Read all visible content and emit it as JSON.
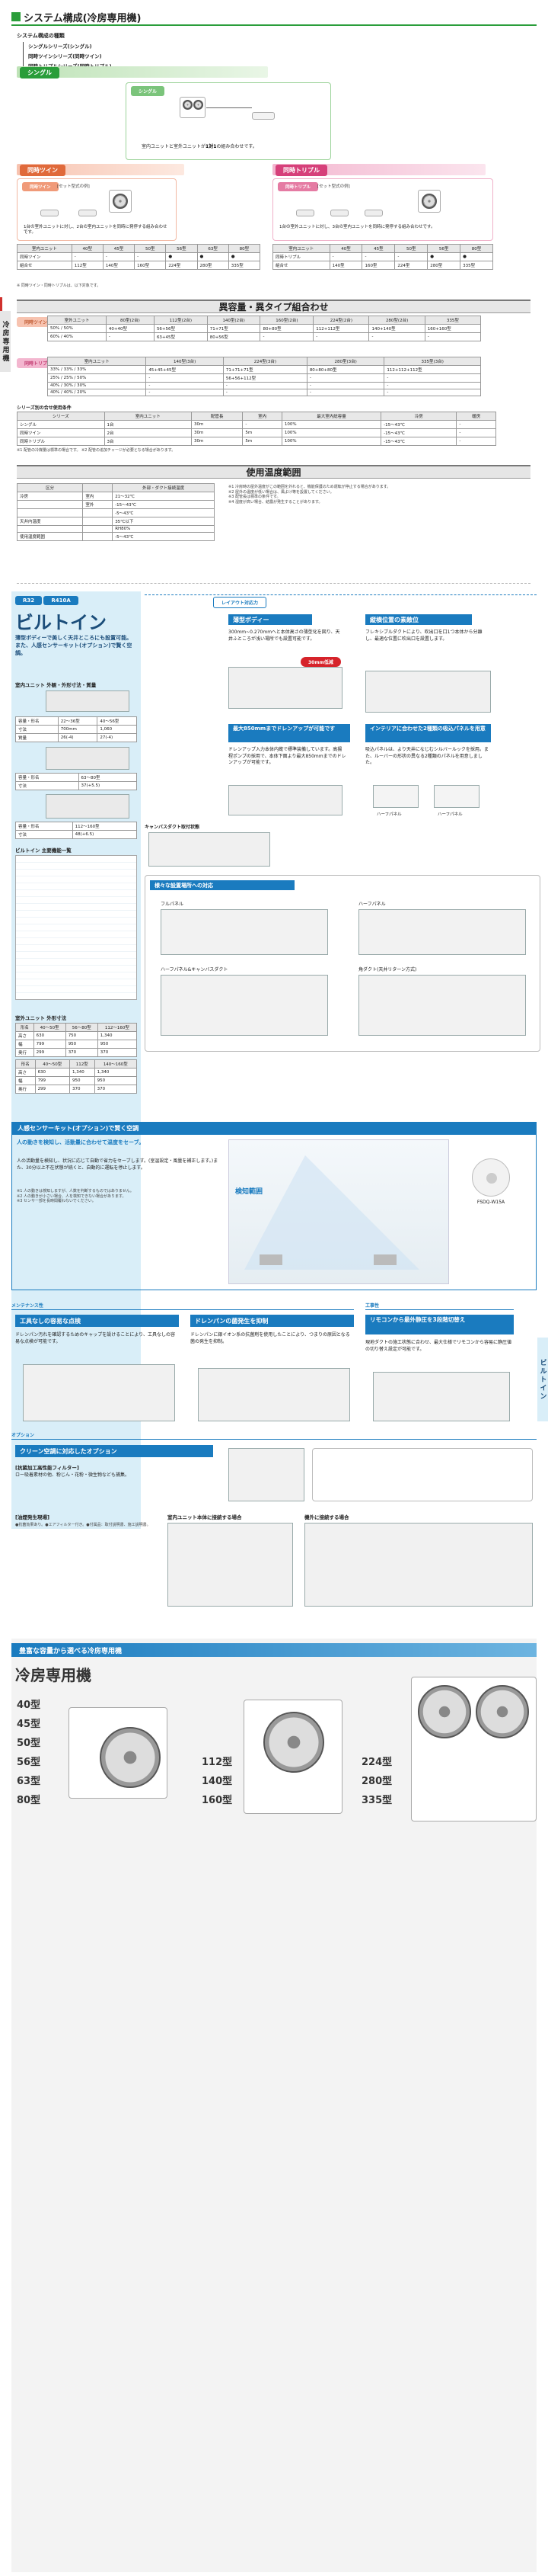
{
  "header": {
    "title": "システム構成(冷房専用機)"
  },
  "system_types": {
    "title": "システム構成の種類",
    "items": [
      "シングルシリーズ(シングル)",
      "同時ツインシリーズ(同時ツイン)",
      "同時トリプルシリーズ(同時トリプル)"
    ]
  },
  "single": {
    "tag": "シングル",
    "tag2": "シングル",
    "caption_pre": "室内ユニットと室外ユニットが",
    "caption_em": "1対1",
    "caption_post": "の組み合わせです。"
  },
  "twin": {
    "tag": "同時ツイン",
    "tag2": "同時ツイン",
    "tag3": "[セット型式の例]",
    "caption": "1台の室外ユニットに対し、2台の室内ユニットを同時に発停する組み合わせです。",
    "note": "※ 同時ツイン・同時トリプルは、以下対象です。"
  },
  "triple": {
    "tag": "同時トリプル",
    "tag2": "同時トリプル",
    "tag3": "[セット型式の例]",
    "caption": "1台の室外ユニットに対し、3台の室内ユニットを同時に発停する組み合わせです。"
  },
  "mixed": {
    "title": "異容量・異タイプ組合わせ",
    "tag_twin": "同時ツイン",
    "tag_triple": "同時トリプル",
    "series_title": "シリーズ別の合せ使用条件",
    "table_headers": [
      "シリーズ",
      "室内ユニット",
      "配管長",
      "室内",
      "最大室内総容量"
    ]
  },
  "temp": {
    "title": "使用温度範囲",
    "headers": [
      "区分",
      "",
      "外部・ダクト接続温度"
    ],
    "rows": [
      [
        "冷房",
        "室内",
        "21～32℃"
      ],
      [
        "",
        "室外",
        "-15～43℃"
      ],
      [
        "",
        "",
        "-5～43℃"
      ],
      [
        "天井内温度",
        "",
        "35℃以下"
      ],
      [
        "",
        "",
        "RH80%"
      ],
      [
        "使用温度範囲",
        "",
        "-5～43℃"
      ]
    ]
  },
  "builtin": {
    "badge1": "R32",
    "badge2": "R410A",
    "title": "ビルトイン",
    "subtitle": "薄型ボディーで美しく天井ところにも設置可能。また、人感センサーキット(オプション)で賢く空調。",
    "unit_dim_title": "室内ユニット 外観・外形寸法・質量",
    "spec_title": "ビルトイン 主要機能一覧",
    "outdoor_title": "室外ユニット 外形寸法",
    "rows": [
      [
        "容量・形名",
        "22～36型",
        "40～56型"
      ],
      [
        "寸法",
        "700mm",
        "1,060"
      ],
      [
        "質量",
        "26(-4)",
        "27(-4)"
      ]
    ],
    "rows2": [
      [
        "容量・形名",
        "63～80型"
      ],
      [
        "寸法",
        "37(+5.5)"
      ]
    ],
    "rows3": [
      [
        "容量・形名",
        "112～160型"
      ],
      [
        "寸法",
        "48(+6.5)"
      ]
    ]
  },
  "features": {
    "badge": "レイアウト対応力",
    "thin": {
      "title": "薄型ボディー",
      "text": "300mm~0.270mmへと本体高さの薄型化を図り、天井ふところが浅い場所でも設置可能です。",
      "tag": "30mm低減"
    },
    "free": {
      "title": "縦横位置の素敵位",
      "text": "フレキシブルダクトにより、吹出口を口1つ本体から分離し、最適な位置に吹出口を設置します。"
    },
    "drain": {
      "title": "最大850mmまでドレンアップが可能です",
      "text": "ドレンアップ入力本体内蔵で標準装備しています。高揚程ポンプの採用で、本体下面より最大850mmまでのドレンアップが可能です。"
    },
    "panel": {
      "title": "インテリアに合わせた2種類の吸込パネルを用意",
      "text": "吸込パネルは、より天井になじむシルバールックを採用。また、ルーバーの形状の異なる2種類のパネルを用意しました。",
      "labels": [
        "ハーフパネル",
        "ハーフパネル"
      ]
    },
    "canvas_title": "キャンバスダクト取付状態",
    "various": {
      "title": "様々な設置場所への対応",
      "labels": [
        "フルパネル",
        "ハーフパネル",
        "ハーフパネル&キャンバスダクト",
        "角ダクト(天井リターン方式)"
      ]
    }
  },
  "sensor": {
    "title": "人感センサーキット(オプション)で賢く空調",
    "sub": "人の動きを検知し、活動量に合わせて温度をセーブ。",
    "text": "人の活動量を検知し、状況に応じて自動で省力をセーブします。(室温設定・風量を補正します。)また、30分以上不在状態が続くと、自動的に運転を停止します。",
    "range": "検知範囲",
    "model": "FSDQ-W15A"
  },
  "maint": {
    "tag": "メンテナンス性",
    "t1": "工具なしの容易な点検",
    "b1": "ドレンパン汚れを確認するためのキャップを設けることにより、工具なしの容易な点検が可能です。",
    "t2": "ドレンパンの菌発生を抑制",
    "b2": "ドレンパンに銀イオン系の抗菌剤を使用したことにより、つまりの原因となる菌の発生を抑制。",
    "tag2": "工事性",
    "t3": "リモコンから最外静圧を3段階切替え",
    "b3": "現地ダクトの施工状態に合わせ、最大仕様でリモコンから容易に静圧値の切り替え設定が可能です。"
  },
  "option": {
    "tag": "オプション",
    "title": "クリーン空調に対応したオプション",
    "sub": "[抗菌加工高性能フィルター]",
    "text": "ロー吸着素材の他、粉じん・花粉・微生物なども捕集。",
    "sub2": "[油煙発生現場]",
    "labels": [
      "室内ユニット本体に接続する場合",
      "機外に接続する場合"
    ]
  },
  "lineup": {
    "banner": "豊富な容量から選べる冷房専用機",
    "title": "冷房専用機",
    "small": [
      "40型",
      "45型",
      "50型",
      "56型",
      "63型",
      "80型"
    ],
    "mid": [
      "112型",
      "140型",
      "160型"
    ],
    "large": [
      "224型",
      "280型",
      "335型"
    ]
  },
  "side": {
    "left": "冷房専用機",
    "right": "ビルトイン"
  },
  "colors": {
    "green": "#2a9d3a",
    "blue": "#1a7bbf",
    "pink": "#d6407a"
  }
}
